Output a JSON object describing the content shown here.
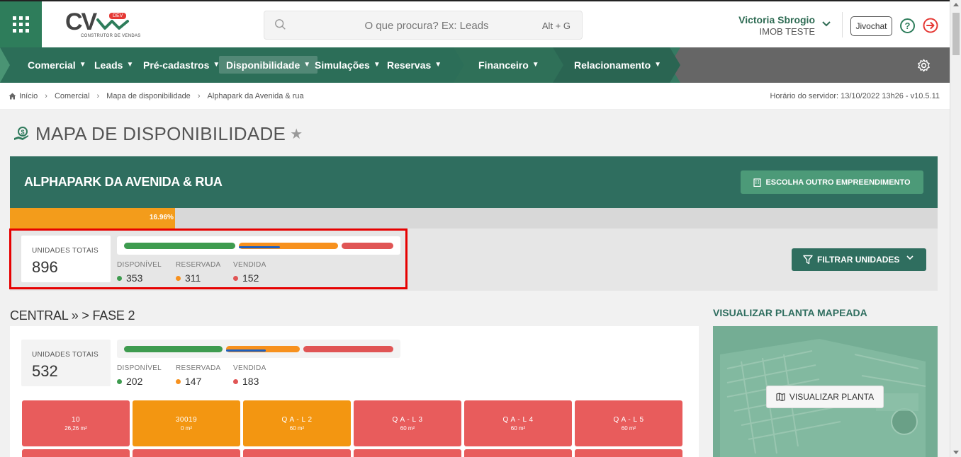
{
  "header": {
    "logo_text": "CV",
    "logo_badge": "DEV",
    "logo_subtitle": "CONSTRUTOR DE VENDAS",
    "search_placeholder": "O que procura? Ex: Leads",
    "search_shortcut": "Alt + G",
    "user_name": "Victoria Sbrogio",
    "user_org": "IMOB TESTE",
    "jivo_label": "Jivochat",
    "help_label": "?"
  },
  "nav": {
    "items": [
      {
        "label": "Comercial"
      },
      {
        "label": "Leads"
      },
      {
        "label": "Pré-cadastros"
      },
      {
        "label": "Disponibilidade"
      },
      {
        "label": "Simulações"
      },
      {
        "label": "Reservas"
      },
      {
        "label": "Financeiro"
      },
      {
        "label": "Relacionamento"
      }
    ],
    "colors": {
      "nav_green_dark": "#2c6e58",
      "nav_green_mid": "#357a62",
      "nav_gray": "#666666"
    }
  },
  "breadcrumb": {
    "items": [
      "Início",
      "Comercial",
      "Mapa de disponibilidade",
      "Alphapark da Avenida & rua"
    ],
    "server_time": "Horário do servidor: 13/10/2022 13h26 - v10.5.11"
  },
  "page": {
    "title": "MAPA DE DISPONIBILIDADE"
  },
  "project": {
    "name": "ALPHAPARK DA AVENIDA & RUA",
    "choose_button": "ESCOLHA OUTRO EMPREENDIMENTO",
    "progress_label": "16.96%",
    "progress_fraction": 0.1696,
    "total_label": "UNIDADES TOTAIS",
    "total_value": "896",
    "disponivel_label": "DISPONÍVEL",
    "disponivel_value": "353",
    "reservada_label": "RESERVADA",
    "reservada_value": "311",
    "vendida_label": "VENDIDA",
    "vendida_value": "152",
    "filter_button": "FILTRAR UNIDADES"
  },
  "section": {
    "title": "CENTRAL » > FASE 2",
    "total_label": "UNIDADES TOTAIS",
    "total_value": "532",
    "disponivel_label": "DISPONÍVEL",
    "disponivel_value": "202",
    "reservada_label": "RESERVADA",
    "reservada_value": "147",
    "vendida_label": "VENDIDA",
    "vendida_value": "183",
    "units": [
      {
        "code": "10",
        "area": "26,26 m²",
        "status": "red"
      },
      {
        "code": "30019",
        "area": "0 m²",
        "status": "orange"
      },
      {
        "code": "Q A - L 2",
        "area": "60 m²",
        "status": "orange"
      },
      {
        "code": "Q A - L 3",
        "area": "60 m²",
        "status": "red"
      },
      {
        "code": "Q A - L 4",
        "area": "60 m²",
        "status": "red"
      },
      {
        "code": "Q A - L 5",
        "area": "60 m²",
        "status": "red"
      }
    ]
  },
  "map": {
    "title": "VISUALIZAR PLANTA MAPEADA",
    "button": "VISUALIZAR PLANTA"
  },
  "colors": {
    "green_dark": "#2f6e5f",
    "disponivel": "#3e9b4f",
    "reservada": "#f7911e",
    "vendida": "#e05555",
    "highlight_box": "#e60000"
  }
}
